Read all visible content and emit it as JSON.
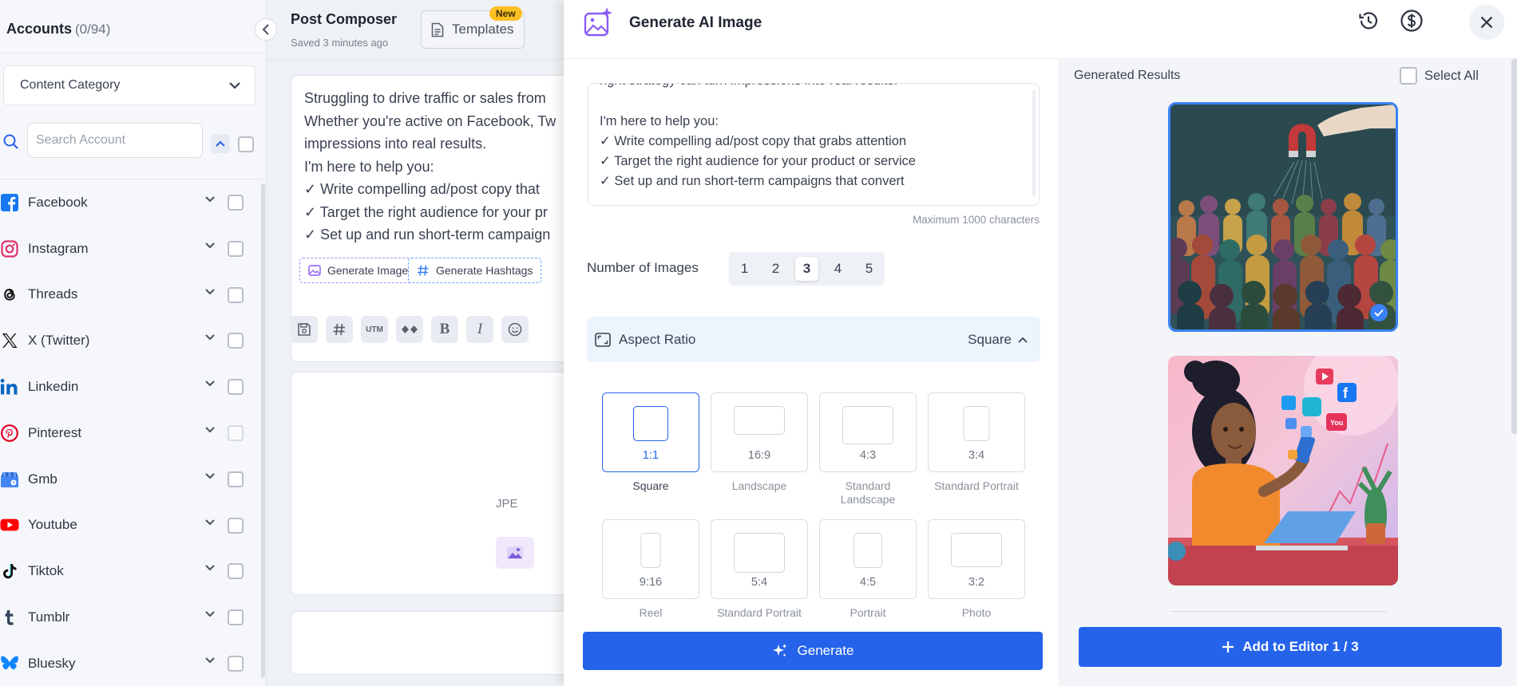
{
  "sidebar": {
    "title": "Accounts",
    "count": "(0/94)",
    "category_select": "Content Category",
    "search_placeholder": "Search Account",
    "accounts": [
      {
        "label": "Facebook",
        "icon": "facebook-icon",
        "color": "#1877f2"
      },
      {
        "label": "Instagram",
        "icon": "instagram-icon",
        "color": "#e1306c"
      },
      {
        "label": "Threads",
        "icon": "threads-icon",
        "color": "#000000"
      },
      {
        "label": "X (Twitter)",
        "icon": "x-twitter-icon",
        "color": "#000000"
      },
      {
        "label": "Linkedin",
        "icon": "linkedin-icon",
        "color": "#0a66c2"
      },
      {
        "label": "Pinterest",
        "icon": "pinterest-icon",
        "color": "#e60023"
      },
      {
        "label": "Gmb",
        "icon": "gmb-icon",
        "color": "#4285f4"
      },
      {
        "label": "Youtube",
        "icon": "youtube-icon",
        "color": "#ff0000"
      },
      {
        "label": "Tiktok",
        "icon": "tiktok-icon",
        "color": "#000000"
      },
      {
        "label": "Tumblr",
        "icon": "tumblr-icon",
        "color": "#35465c"
      },
      {
        "label": "Bluesky",
        "icon": "bluesky-icon",
        "color": "#1185fe"
      }
    ]
  },
  "composer": {
    "title": "Post Composer",
    "saved": "Saved 3 minutes ago",
    "templates_label": "Templates",
    "new_badge": "New",
    "editor_lines": [
      "Struggling to drive traffic or sales from",
      "Whether you're active on Facebook, Tw",
      "impressions into real results.",
      "I'm here to help you:",
      "✓ Write compelling ad/post copy that",
      "✓ Target the right audience for your pr",
      "✓ Set up and run short-term campaign"
    ],
    "generate_image_label": "Generate Image",
    "generate_hashtags_label": "Generate Hashtags",
    "media_hint": "JPE"
  },
  "panel": {
    "title": "Generate AI Image",
    "prompt_text": "right strategy can turn impressions into real results.\n\nI'm here to help you:\n✓ Write compelling ad/post copy that grabs attention\n✓ Target the right audience for your product or service\n✓ Set up and run short-term campaigns that convert",
    "max_chars": "Maximum 1000 characters",
    "num_images_label": "Number of Images",
    "num_options": [
      "1",
      "2",
      "3",
      "4",
      "5"
    ],
    "num_selected": "3",
    "aspect_label": "Aspect Ratio",
    "aspect_value": "Square",
    "ratios": [
      {
        "value": "1:1",
        "name": "Square",
        "active": true
      },
      {
        "value": "16:9",
        "name": "Landscape"
      },
      {
        "value": "4:3",
        "name": "Standard Landscape"
      },
      {
        "value": "3:4",
        "name": "Standard Portrait"
      },
      {
        "value": "9:16",
        "name": "Reel"
      },
      {
        "value": "5:4",
        "name": "Standard Portrait"
      },
      {
        "value": "4:5",
        "name": "Portrait"
      },
      {
        "value": "3:2",
        "name": "Photo"
      }
    ],
    "generate_label": "Generate",
    "results_title": "Generated Results",
    "select_all": "Select All",
    "add_to_editor": "Add to Editor 1 / 3",
    "accent": "#2563eb"
  }
}
